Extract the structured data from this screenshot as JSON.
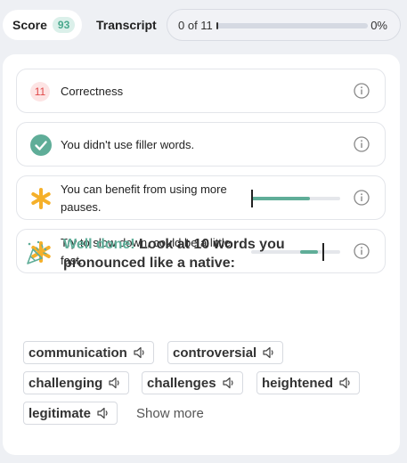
{
  "tabs": {
    "score_label": "Score",
    "score_value": "93",
    "transcript_label": "Transcript"
  },
  "progress": {
    "count_text": "0 of 11",
    "percent_text": "0%",
    "fraction": 0
  },
  "cards": {
    "correctness": {
      "badge": "11",
      "label": "Correctness"
    },
    "filler": {
      "label": "You didn't use filler words."
    },
    "pauses": {
      "line1": "You can benefit from using more",
      "line2": "pauses.",
      "meter_value": 0.66,
      "marker_value": 0.0
    },
    "pace": {
      "line1": "Try to slow down, could be a little",
      "line2": "fast.",
      "meter_start": 0.55,
      "meter_value": 0.75,
      "marker_value": 0.8
    }
  },
  "native": {
    "accent": "Well done!",
    "rest": " Look at 10 words you pronounced like a native:",
    "words": [
      "communication",
      "controversial",
      "challenging",
      "challenges",
      "heightened",
      "legitimate"
    ],
    "show_more": "Show more"
  },
  "colors": {
    "accent_green": "#5fad98",
    "warning_orange": "#f5b02a",
    "error_red": "#e04848"
  },
  "icons": {
    "info": "info-circle-icon",
    "check": "check-circle-icon",
    "star": "asterisk-icon",
    "speaker": "speaker-icon",
    "party": "party-popper-icon"
  }
}
